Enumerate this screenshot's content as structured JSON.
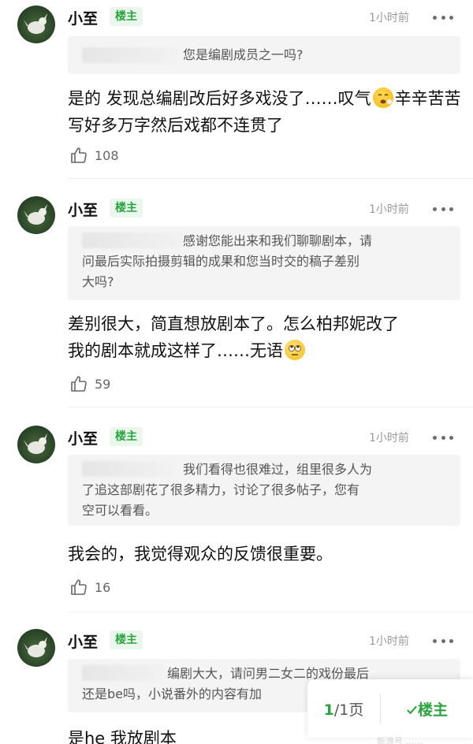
{
  "comments": [
    {
      "username": "小至",
      "badge": "楼主",
      "time": "1小时前",
      "quote": "您是编剧成员之一吗?",
      "reply_parts": [
        "是的 发现总编剧改后好多戏没了……叹气",
        "辛辛苦苦写好多万字然后戏都不连贯了"
      ],
      "emoji": "tired-face-emoji",
      "likes": "108"
    },
    {
      "username": "小至",
      "badge": "楼主",
      "time": "1小时前",
      "quote_lines": [
        "感谢您能出来和我们聊聊剧本，请",
        "问最后实际拍摄剪辑的成果和您当时交的稿子差别",
        "大吗?"
      ],
      "reply_parts": [
        "差别很大，简直想放剧本了。怎么柏邦妮改了",
        "我的剧本就成这样了……无语"
      ],
      "emoji": "eye-roll-emoji",
      "likes": "59"
    },
    {
      "username": "小至",
      "badge": "楼主",
      "time": "1小时前",
      "quote_lines": [
        "我们看得也很难过，组里很多人为",
        "了追这部剧花了很多精力，讨论了很多帖子，您有",
        "空可以看看。"
      ],
      "reply": "我会的，我觉得观众的反馈很重要。",
      "likes": "16"
    },
    {
      "username": "小至",
      "badge": "楼主",
      "time": "1小时前",
      "quote_lines": [
        "编剧大大，请问男二女二的戏份最后",
        "还是be吗，小说番外的内容有加"
      ],
      "reply": "是he 我放剧本"
    }
  ],
  "pager": {
    "current": "1",
    "total": "/1页",
    "op_only": "楼主",
    "check_icon": "check-icon"
  },
  "watermark": "新浪号 ……",
  "colors": {
    "accent": "#2ba33f",
    "badge_bg": "#e9f7ec",
    "quote_bg": "#f4f4f4"
  }
}
